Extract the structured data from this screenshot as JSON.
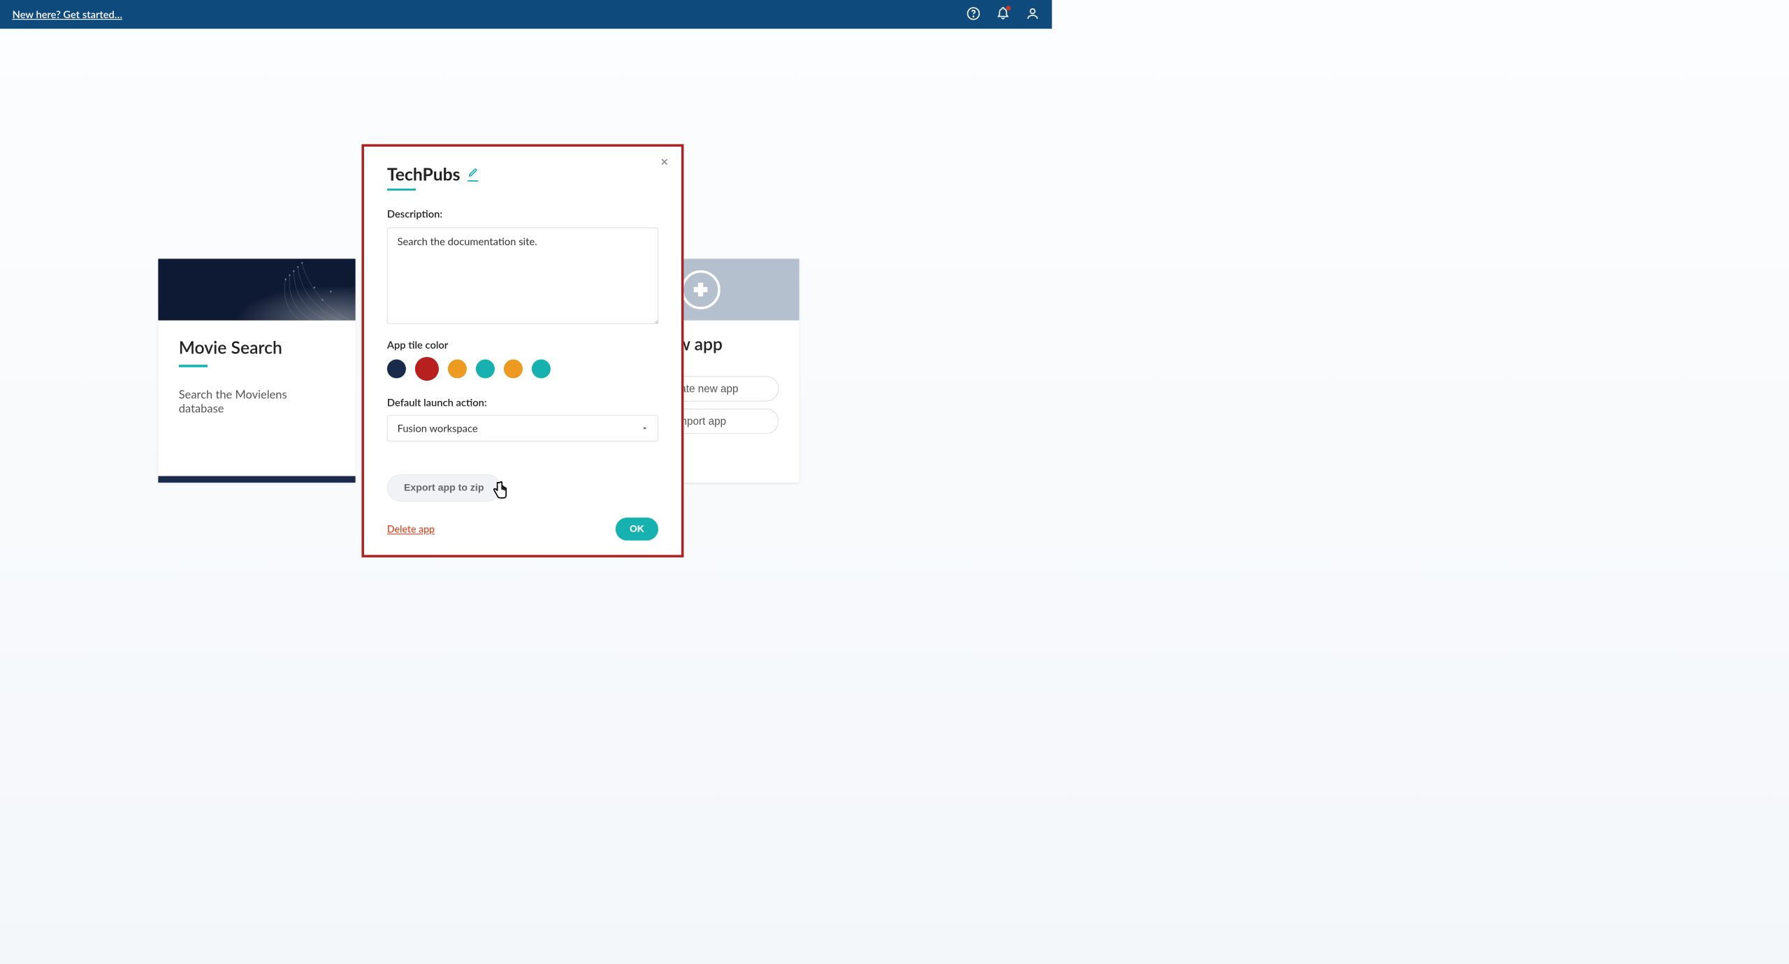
{
  "topbar": {
    "get_started_label": "New here? Get started…"
  },
  "cards": {
    "movie": {
      "title": "Movie Search",
      "description": "Search the Movielens database"
    },
    "addnew": {
      "title": "Add new app",
      "create_label": "Create new app",
      "import_label": "Import app"
    }
  },
  "modal": {
    "title": "TechPubs",
    "description_label": "Description:",
    "description_value": "Search the documentation site.",
    "tile_color_label": "App tile color",
    "colors": [
      {
        "hex": "#1a2a4a",
        "name": "navy",
        "selected": false
      },
      {
        "hex": "#b8201f",
        "name": "red",
        "selected": true
      },
      {
        "hex": "#ec9a22",
        "name": "orange",
        "selected": false
      },
      {
        "hex": "#17b2b0",
        "name": "teal",
        "selected": false
      },
      {
        "hex": "#ec9a22",
        "name": "orange2",
        "selected": false
      },
      {
        "hex": "#17b2b0",
        "name": "teal2",
        "selected": false
      }
    ],
    "launch_label": "Default launch action:",
    "launch_value": "Fusion workspace",
    "export_label": "Export app to zip",
    "delete_label": "Delete app",
    "ok_label": "OK"
  }
}
